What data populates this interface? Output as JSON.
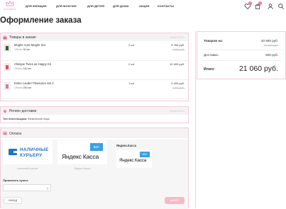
{
  "nav": {
    "brand": "NATURERY",
    "menu": [
      "ДЛЯ ЖЕНЩИН",
      "ДЛЯ МУЖЧИН",
      "ДЛЯ ДЕТЕЙ",
      "ДЛЯ ДОМА",
      "АКЦИИ",
      "КОНТАКТЫ"
    ],
    "favorites_count": "0",
    "cart_count": "3"
  },
  "page_title": "Оформление заказа",
  "cart": {
    "title": "Товары в заказе",
    "edit_label": "ИЗМЕНИТЬ",
    "volume_label": "Объём",
    "items": [
      {
        "name": "Mugler Aura Mugler Set",
        "volume": "30 мл",
        "qty": "2 шт",
        "price": "5 760 руб.",
        "old_price": "6 400 руб.",
        "color": "#3d5a2e"
      },
      {
        "name": "Clinique Twice as Happy Kit",
        "volume": "150 мл",
        "qty": "2 шт",
        "price": "10 400 руб.",
        "old_price": "",
        "color": "#d05a6b"
      },
      {
        "name": "Estee Lauder Pleasures Set 2",
        "volume": "250 мл",
        "qty": "1 шт",
        "price": "4 400 руб.",
        "old_price": "6 500 руб.",
        "color": "#b88a9a"
      }
    ]
  },
  "delivery": {
    "title": "Регион доставки",
    "edit_label": "ИЗМЕНИТЬ",
    "payer_label": "Тип плательщика:",
    "payer_value": "Физическое лицо"
  },
  "payment": {
    "title": "Оплата",
    "cash_line1": "НАЛИЧНЫЕ",
    "cash_line2": "КУРЬЕРУ",
    "cash_caption": "Наличный расчет",
    "yandex_text": "Яндекс Касса",
    "yandex_badge": "B2C",
    "yandex_caption": "Яндекс.Касса",
    "selected_title": "Яндекс.Касса",
    "coupon_label": "Применить купон:",
    "coupon_value": "",
    "back_label": "НАЗАД",
    "next_label": "ДАЛЕЕ"
  },
  "summary": {
    "goods_label": "Товаров на:",
    "goods_value": "20 560 руб.",
    "goods_old": "21 200 руб.",
    "delivery_label": "Доставка:",
    "delivery_value": "500 руб.",
    "total_label": "Итого:",
    "total_value": "21 060 руб."
  },
  "colors": {
    "accent": "#ee6e90",
    "border": "#f2cdd9",
    "cash_blue": "#1f73c8",
    "yandex_red": "#e8221d",
    "b2c_blue": "#3aa0e6"
  }
}
